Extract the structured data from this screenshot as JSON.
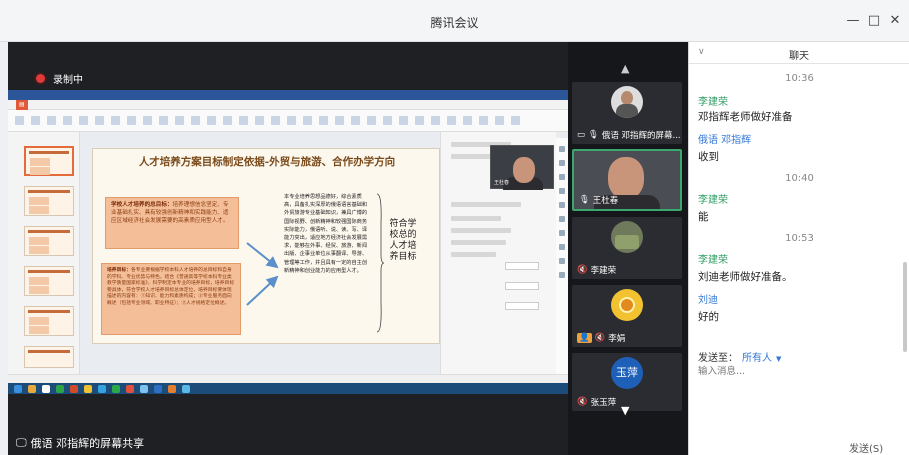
{
  "window": {
    "title": "腾讯会议",
    "minimize": "—",
    "maximize": "□",
    "close": "✕"
  },
  "share": {
    "recording_label": "录制中",
    "caption": "俄语 邓指辉的屏幕共享",
    "slide": {
      "title": "人才培养方案目标制定依据-外贸与旅游、合作办学方向",
      "box1_title": "学校人才培养的总目标：",
      "box1_body": "培养理想信念坚定、专业基础扎实、具有较强创新精神和实践能力、适应区域经济社会发展需要的高素质应用型人才。",
      "box2_title": "培养目标：",
      "box2_body": "各专业要根据学校本科人才培养的总目标和自身的学科、专业优势与特色，结合《普通高等学校本科专业类教学质量国家标准》，科学制定本专业的培养目标，培养目标要具体，符合学校人才培养目标总体定位，培养目标要体现描述的内容有：①知识、能力和素质构成；②专业服务面向概述（包括专业领域、职业特征）；③人才规格定位概述。",
      "middle": "本专业培养思想品德好，综合素质高，具备扎实深厚的俄语语言基础和外贸旅游专业基础知识，兼具广博的国际视野、创新精神和较强国际商务实际能力，俄语听、说、读、写、译能力突出，适应地方经济社会发展需求，能够在外事、经贸、旅游、新闻出版、企事业单位从事翻译、导游、管理等工作，并且具有一定的自主创新精神和创业能力的应用型人才。",
      "right": "符合学校总的人才培养目标"
    },
    "mini_cam_label": "王杜春"
  },
  "participants": [
    {
      "name": "俄语 邓指辉的屏幕...",
      "sharing": true,
      "mic": true
    },
    {
      "name": "王杜春",
      "mic": true,
      "active": true
    },
    {
      "name": "李建荣",
      "muted": true
    },
    {
      "name": "李娟",
      "muted": true
    },
    {
      "name": "张玉萍",
      "avatar_text": "玉萍",
      "muted": true
    }
  ],
  "chat": {
    "title": "聊天",
    "messages": [
      {
        "time": "10:36"
      },
      {
        "name": "李建荣",
        "text": "邓指辉老师做好准备",
        "color": "#2f9a62"
      },
      {
        "name": "俄语 邓指辉",
        "text": "收到",
        "color": "#3478d6"
      },
      {
        "time": "10:40"
      },
      {
        "name": "李建荣",
        "text": "能",
        "color": "#2f9a62"
      },
      {
        "time": "10:53"
      },
      {
        "name": "李建荣",
        "text": "刘迪老师做好准备。",
        "color": "#2f9a62"
      },
      {
        "name": "刘迪",
        "text": "好的",
        "color": "#3478d6"
      }
    ],
    "send_to_label": "发送至：",
    "send_to_value": "所有人",
    "input_placeholder": "输入消息...",
    "send_button": "发送(S)"
  },
  "colors": {
    "accent_green": "#2f9a62",
    "accent_blue": "#3478d6",
    "recording": "#e23a3a"
  }
}
